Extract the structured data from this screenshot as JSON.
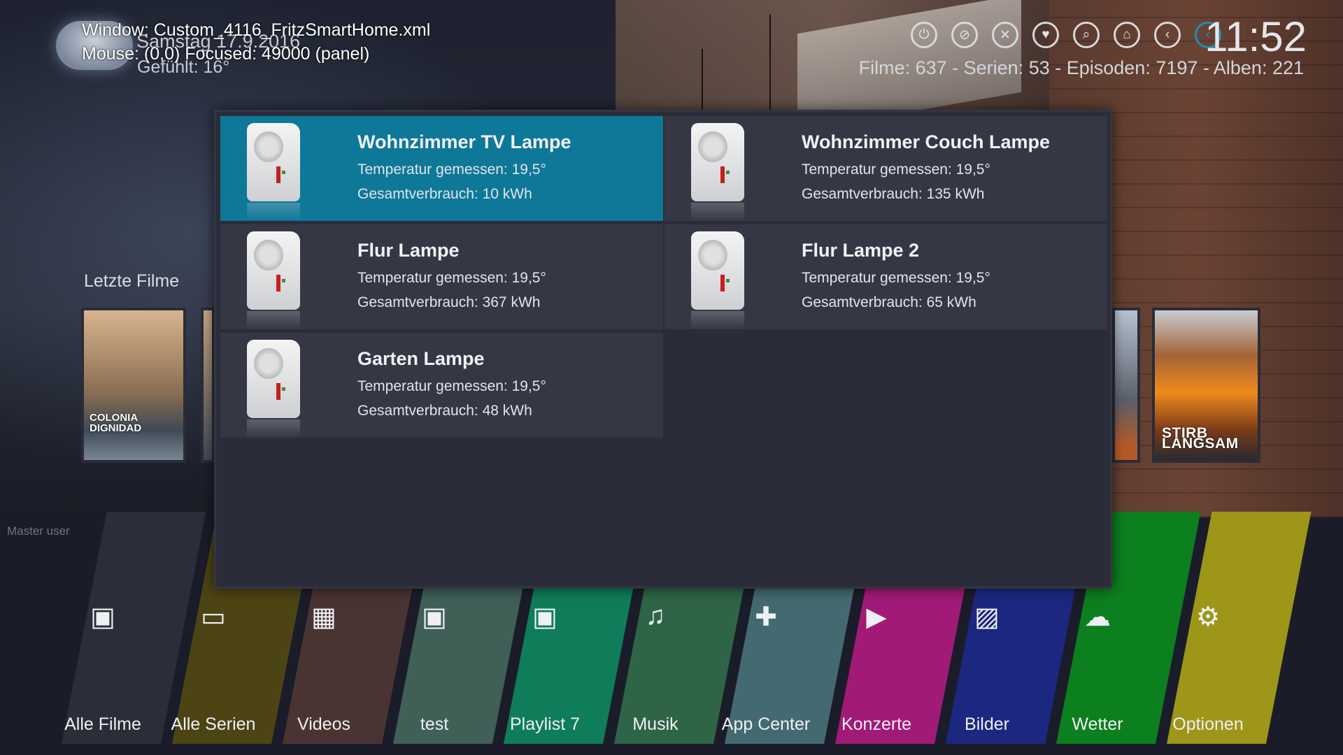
{
  "debug": {
    "window": "Window: Custom_4116_FritzSmartHome.xml",
    "mouse": "Mouse: (0,0)  Focused: 49000 (panel)"
  },
  "weather": {
    "date": "Samstag 17.9.2016",
    "condition": "Gefühlt: 16°"
  },
  "topbar": {
    "icons": [
      "power-icon",
      "no-image-icon",
      "tools-icon",
      "heart-icon",
      "search-icon",
      "home-icon",
      "back-icon",
      "back-active-icon"
    ],
    "clock": "11:52",
    "stats": "Filme: 637 - Serien: 53 - Episoden: 7197 - Alben: 221",
    "accent": "#1a8fb8"
  },
  "recent": {
    "label": "Letzte Filme",
    "posters": [
      {
        "title": "COLONIA DIGNIDAD"
      },
      {
        "title": "STIRB LANGSAM"
      }
    ]
  },
  "user": {
    "label": "Master user"
  },
  "devices": [
    {
      "name": "Wohnzimmer TV Lampe",
      "temperature": "Temperatur gemessen: 19,5°",
      "consumption": "Gesamtverbrauch: 10 kWh",
      "focused": true
    },
    {
      "name": "Wohnzimmer Couch Lampe",
      "temperature": "Temperatur gemessen: 19,5°",
      "consumption": "Gesamtverbrauch: 135 kWh",
      "focused": false
    },
    {
      "name": "Flur Lampe",
      "temperature": "Temperatur gemessen: 19,5°",
      "consumption": "Gesamtverbrauch: 367 kWh",
      "focused": false
    },
    {
      "name": "Flur Lampe 2",
      "temperature": "Temperatur gemessen: 19,5°",
      "consumption": "Gesamtverbrauch: 65 kWh",
      "focused": false
    },
    {
      "name": "Garten Lampe",
      "temperature": "Temperatur gemessen: 19,5°",
      "consumption": "Gesamtverbrauch: 48 kWh",
      "focused": false
    }
  ],
  "menu": [
    {
      "label": "Alle Filme",
      "icon": "movies-icon",
      "color": "#2b2d38"
    },
    {
      "label": "Alle Serien",
      "icon": "tv-icon",
      "color": "#4d4414"
    },
    {
      "label": "Videos",
      "icon": "film-icon",
      "color": "#4a3431"
    },
    {
      "label": "test",
      "icon": "playlist-icon",
      "color": "#3f5f57"
    },
    {
      "label": "Playlist 7",
      "icon": "playlist-icon",
      "color": "#0f7c5a"
    },
    {
      "label": "Musik",
      "icon": "music-icon",
      "color": "#2e6546"
    },
    {
      "label": "App Center",
      "icon": "puzzle-icon",
      "color": "#436a70"
    },
    {
      "label": "Konzerte",
      "icon": "play-icon",
      "color": "#a11a78"
    },
    {
      "label": "Bilder",
      "icon": "pictures-icon",
      "color": "#1c2780"
    },
    {
      "label": "Wetter",
      "icon": "weather-icon",
      "color": "#0c7f1f"
    },
    {
      "label": "Optionen",
      "icon": "settings-icon",
      "color": "#9d9618"
    }
  ]
}
